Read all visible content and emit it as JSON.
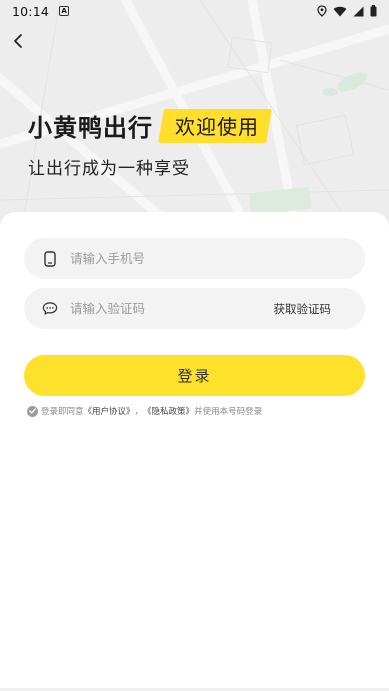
{
  "status_bar": {
    "time": "10:14",
    "notification_icon": "A",
    "icons": [
      "location-icon",
      "wifi-icon",
      "signal-icon",
      "battery-icon"
    ]
  },
  "header": {
    "app_name": "小黄鸭出行",
    "welcome_badge": "欢迎使用",
    "slogan": "让出行成为一种享受"
  },
  "form": {
    "phone_placeholder": "请输入手机号",
    "code_placeholder": "请输入验证码",
    "get_code_label": "获取验证码",
    "login_label": "登录"
  },
  "agreement": {
    "prefix": "登录即同意",
    "user_agreement": "《用户协议》",
    "separator": "，",
    "privacy_policy": "《隐私政策》",
    "suffix": "并使用本号码登录"
  },
  "colors": {
    "accent": "#fde12b",
    "field_bg": "#f3f3f3",
    "map_bg": "#ececec"
  }
}
